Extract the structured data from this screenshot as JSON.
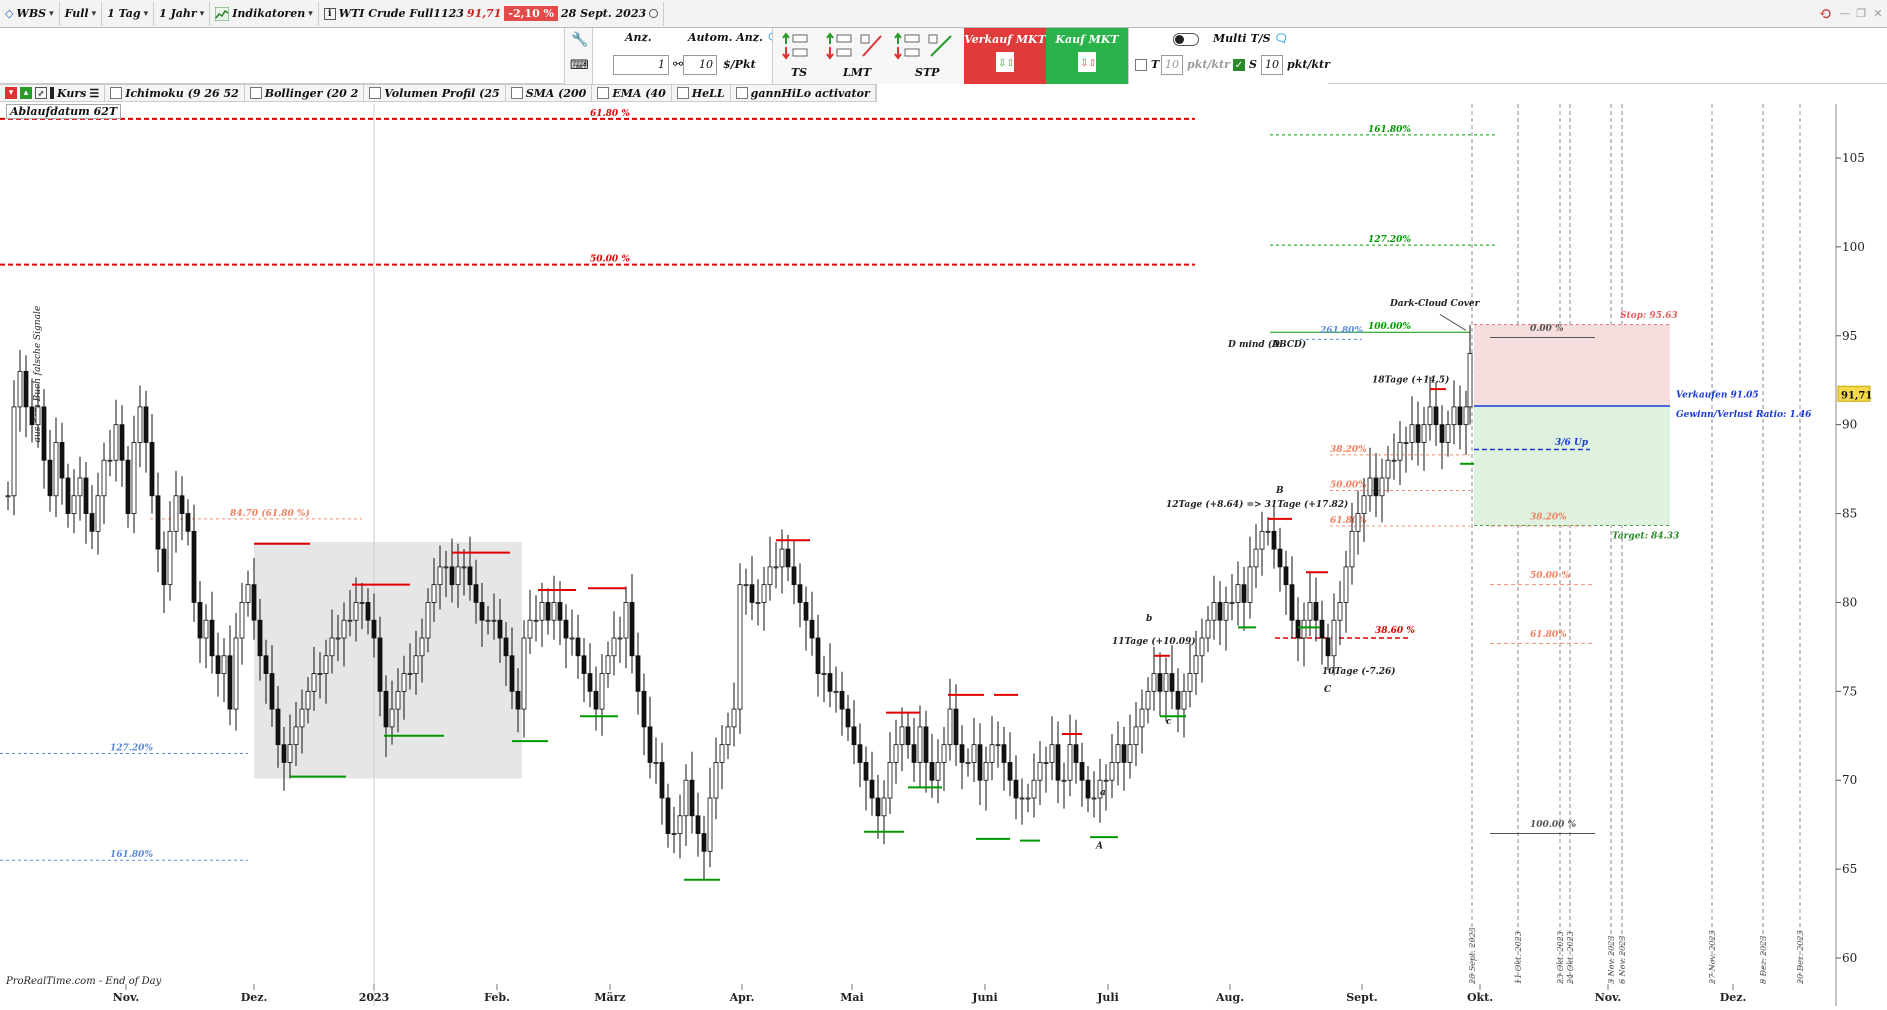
{
  "toolbar": {
    "ticker": "WBS",
    "mode": "Full",
    "interval": "1 Tag",
    "range": "1 Jahr",
    "indicators": "Indikatoren",
    "instrument": "WTI Crude Full1123",
    "price": "91,71",
    "change": "-2,10 %",
    "date": "28 Sept. 2023"
  },
  "order": {
    "qty_label": "Anz.",
    "qty_value": "1",
    "auto_label": "Autom. Anz.",
    "pts_value": "10",
    "pts_unit": "$/Pkt",
    "ts_label": "TS",
    "lmt_label": "LMT",
    "stp_label": "STP",
    "sell_label": "Verkauf MKT",
    "buy_label": "Kauf MKT",
    "multi_label": "Multi T/S",
    "t_label": "T",
    "t_value": "10",
    "t_unit": "pkt/ktr",
    "s_label": "S",
    "s_value": "10",
    "s_unit": "pkt/ktr"
  },
  "indicators_bar": [
    {
      "name": "kurs",
      "label": "Kurs"
    },
    {
      "name": "ichimoku",
      "label": "Ichimoku (9 26 52"
    },
    {
      "name": "bollinger",
      "label": "Bollinger (20 2"
    },
    {
      "name": "volumen",
      "label": "Volumen Profil (25"
    },
    {
      "name": "sma",
      "label": "SMA (200"
    },
    {
      "name": "ema",
      "label": "EMA (40"
    },
    {
      "name": "hell",
      "label": "HeLL"
    },
    {
      "name": "gann",
      "label": "gannHiLo activator"
    }
  ],
  "expiry_label": "Ablaufdatum  62T",
  "source": "ProRealTime.com - End of Day",
  "colors": {
    "up": "#ffffff",
    "down": "#111111",
    "red": "#e00000",
    "green": "#009900",
    "blue": "#2255dd",
    "stopzone": "#f7dede",
    "targetzone": "#dff2df"
  },
  "chart_data": {
    "type": "candlestick",
    "y_axis": {
      "ticks": [
        105,
        100,
        95,
        90,
        85,
        80,
        75,
        70,
        65,
        60
      ],
      "current_price": "91,71"
    },
    "x_axis": {
      "ticks": [
        "Nov.",
        "Dez.",
        "2023",
        "Feb.",
        "März",
        "Apr.",
        "Mai",
        "Juni",
        "Juli",
        "Aug.",
        "Sept.",
        "Okt.",
        "Nov.",
        "Dez."
      ]
    },
    "vertical_dates": [
      "28 Sept. 2023",
      "11 Okt. 2023",
      "23 Okt. 2023",
      "24 Okt. 2023",
      "3 Nov. 2023",
      "6 Nov. 2023",
      "27 Nov. 2023",
      "8 Dez. 2023",
      "20 Dez. 2023"
    ],
    "fib_red": [
      {
        "label": "61.80 %",
        "value": 107.2
      },
      {
        "label": "50.00 %",
        "value": 99.0
      }
    ],
    "fib_blue_left": [
      {
        "label": "127.20%",
        "value": 71.5
      },
      {
        "label": "161.80%",
        "value": 65.5
      }
    ],
    "fib_orange_left": {
      "label": "84.70 (61.80 %)",
      "value": 84.7
    },
    "fib_green": [
      {
        "label": "161.80%",
        "value": 106.3
      },
      {
        "label": "127.20%",
        "value": 100.1
      },
      {
        "label": "100.00%",
        "value": 95.2
      }
    ],
    "fib_blue_right": {
      "label": "261.80%",
      "value": 94.8
    },
    "retrace_right": [
      {
        "label": "38.20%",
        "value": 88.3
      },
      {
        "label": "50.00%",
        "value": 86.3
      },
      {
        "label": "61.80%",
        "value": 84.3
      }
    ],
    "projection": [
      {
        "label": "0.00 %",
        "value": 94.9
      },
      {
        "label": "38.20%",
        "value": 84.3
      },
      {
        "label": "50.00 %",
        "value": 81.0
      },
      {
        "label": "61.80%",
        "value": 77.7
      },
      {
        "label": "100.00 %",
        "value": 67.0
      }
    ],
    "red_level": {
      "label": "38.60 %",
      "value": 78.0
    },
    "trade": {
      "stop_label": "Stop: 95.63",
      "stop": 95.63,
      "entry_label": "Verkaufen 91.05",
      "entry": 91.05,
      "rr_label": "Gewinn/Verlust Ratio: 1.46",
      "target_label": "Target: 84.33",
      "target": 84.33,
      "mid_label": "3/6 Up",
      "mid": 88.6
    },
    "annotations": [
      "Dark-Cloud Cover",
      "D mind (ABCD)",
      "18Tage (+14.5)",
      "12Tage (+8.64) => 31Tage (+17.82)",
      "11Tage (+10.09)",
      "10Tage (-7.26)",
      "A",
      "B",
      "C",
      "D",
      "a",
      "b",
      "c"
    ],
    "side_text": "aus dem Buch falsche Signale"
  }
}
